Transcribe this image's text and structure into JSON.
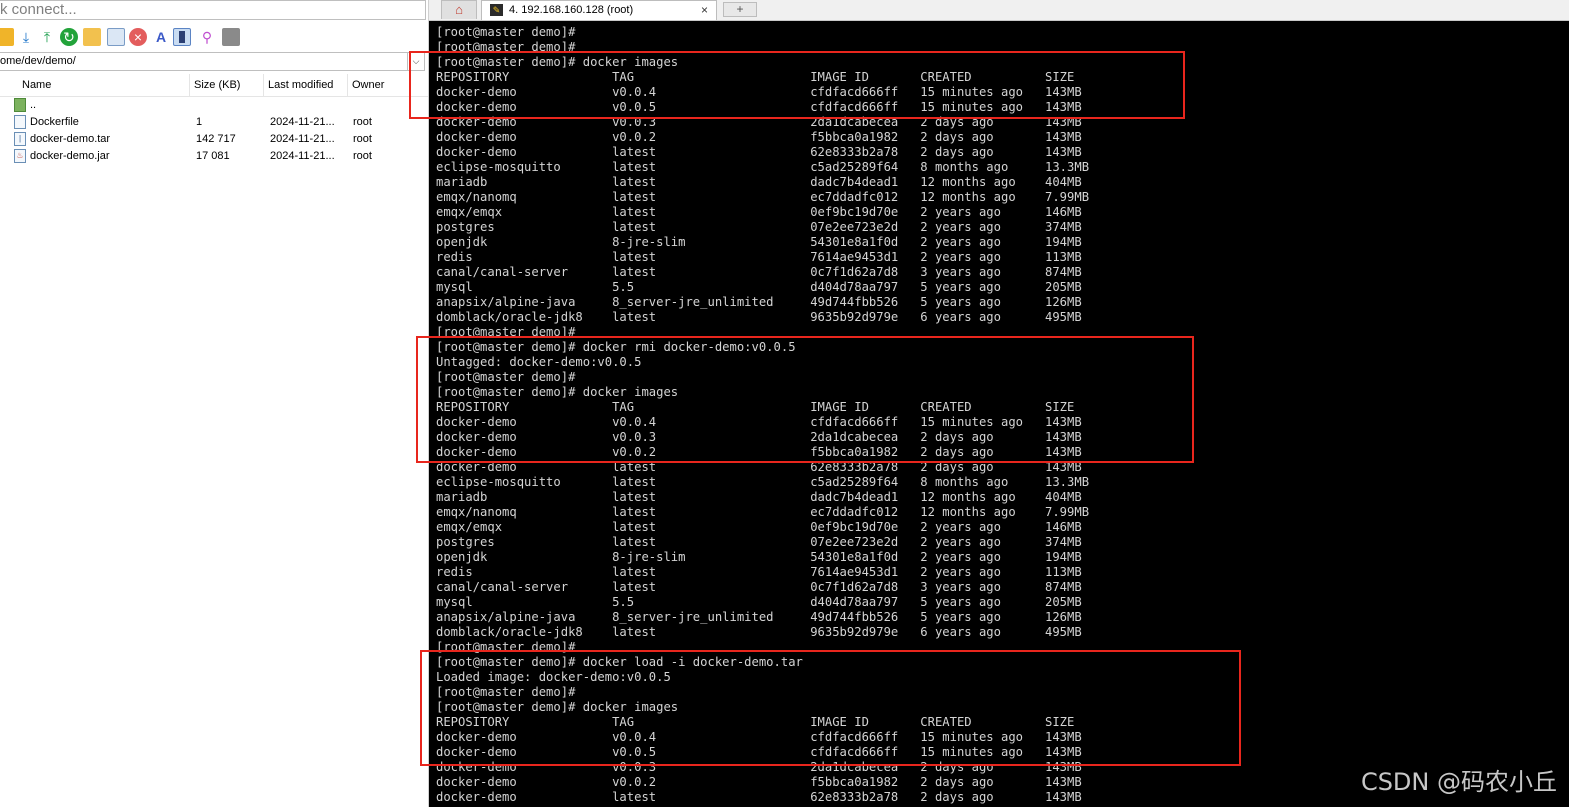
{
  "left_pane": {
    "quick_connect_text": "k connect...",
    "toolbar_icons": [
      "folder-icon",
      "download-icon",
      "upload-icon",
      "refresh-icon",
      "new-folder-icon",
      "new-file-icon",
      "delete-icon",
      "rename-icon",
      "properties-icon",
      "permissions-icon",
      "terminal-icon"
    ],
    "path": "ome/dev/demo/",
    "columns": {
      "name": "Name",
      "size": "Size (KB)",
      "modified": "Last modified",
      "owner": "Owner"
    },
    "files": [
      {
        "name": "..",
        "size": "",
        "modified": "",
        "owner": "",
        "icon": "parent-folder-icon"
      },
      {
        "name": "Dockerfile",
        "size": "1",
        "modified": "2024-11-21...",
        "owner": "root",
        "icon": "file-icon"
      },
      {
        "name": "docker-demo.tar",
        "size": "142 717",
        "modified": "2024-11-21...",
        "owner": "root",
        "icon": "archive-icon"
      },
      {
        "name": "docker-demo.jar",
        "size": "17 081",
        "modified": "2024-11-21...",
        "owner": "root",
        "icon": "jar-icon"
      }
    ]
  },
  "tabs": {
    "home_icon": "home-icon",
    "session_title": "4. 192.168.160.128 (root)",
    "close_glyph": "×",
    "new_tab_glyph": "+"
  },
  "terminal": {
    "lines": [
      "[root@master demo]#",
      "[root@master demo]#",
      "[root@master demo]# docker images",
      "REPOSITORY              TAG                        IMAGE ID       CREATED          SIZE",
      "docker-demo             v0.0.4                     cfdfacd666ff   15 minutes ago   143MB",
      "docker-demo             v0.0.5                     cfdfacd666ff   15 minutes ago   143MB",
      "docker-demo             v0.0.3                     2da1dcabecea   2 days ago       143MB",
      "docker-demo             v0.0.2                     f5bbca0a1982   2 days ago       143MB",
      "docker-demo             latest                     62e8333b2a78   2 days ago       143MB",
      "eclipse-mosquitto       latest                     c5ad25289f64   8 months ago     13.3MB",
      "mariadb                 latest                     dadc7b4dead1   12 months ago    404MB",
      "emqx/nanomq             latest                     ec7ddadfc012   12 months ago    7.99MB",
      "emqx/emqx               latest                     0ef9bc19d70e   2 years ago      146MB",
      "postgres                latest                     07e2ee723e2d   2 years ago      374MB",
      "openjdk                 8-jre-slim                 54301e8a1f0d   2 years ago      194MB",
      "redis                   latest                     7614ae9453d1   2 years ago      113MB",
      "canal/canal-server      latest                     0c7f1d62a7d8   3 years ago      874MB",
      "mysql                   5.5                        d404d78aa797   5 years ago      205MB",
      "anapsix/alpine-java     8_server-jre_unlimited     49d744fbb526   5 years ago      126MB",
      "domblack/oracle-jdk8    latest                     9635b92d979e   6 years ago      495MB",
      "[root@master demo]#",
      "[root@master demo]# docker rmi docker-demo:v0.0.5",
      "Untagged: docker-demo:v0.0.5",
      "[root@master demo]#",
      "[root@master demo]# docker images",
      "REPOSITORY              TAG                        IMAGE ID       CREATED          SIZE",
      "docker-demo             v0.0.4                     cfdfacd666ff   15 minutes ago   143MB",
      "docker-demo             v0.0.3                     2da1dcabecea   2 days ago       143MB",
      "docker-demo             v0.0.2                     f5bbca0a1982   2 days ago       143MB",
      "docker-demo             latest                     62e8333b2a78   2 days ago       143MB",
      "eclipse-mosquitto       latest                     c5ad25289f64   8 months ago     13.3MB",
      "mariadb                 latest                     dadc7b4dead1   12 months ago    404MB",
      "emqx/nanomq             latest                     ec7ddadfc012   12 months ago    7.99MB",
      "emqx/emqx               latest                     0ef9bc19d70e   2 years ago      146MB",
      "postgres                latest                     07e2ee723e2d   2 years ago      374MB",
      "openjdk                 8-jre-slim                 54301e8a1f0d   2 years ago      194MB",
      "redis                   latest                     7614ae9453d1   2 years ago      113MB",
      "canal/canal-server      latest                     0c7f1d62a7d8   3 years ago      874MB",
      "mysql                   5.5                        d404d78aa797   5 years ago      205MB",
      "anapsix/alpine-java     8_server-jre_unlimited     49d744fbb526   5 years ago      126MB",
      "domblack/oracle-jdk8    latest                     9635b92d979e   6 years ago      495MB",
      "[root@master demo]#",
      "[root@master demo]# docker load -i docker-demo.tar",
      "Loaded image: docker-demo:v0.0.5",
      "[root@master demo]#",
      "[root@master demo]# docker images",
      "REPOSITORY              TAG                        IMAGE ID       CREATED          SIZE",
      "docker-demo             v0.0.4                     cfdfacd666ff   15 minutes ago   143MB",
      "docker-demo             v0.0.5                     cfdfacd666ff   15 minutes ago   143MB",
      "docker-demo             v0.0.3                     2da1dcabecea   2 days ago       143MB",
      "docker-demo             v0.0.2                     f5bbca0a1982   2 days ago       143MB",
      "docker-demo             latest                     62e8333b2a78   2 days ago       143MB"
    ],
    "highlight_color": "#e8261d"
  },
  "watermark": "CSDN @码农小丘"
}
